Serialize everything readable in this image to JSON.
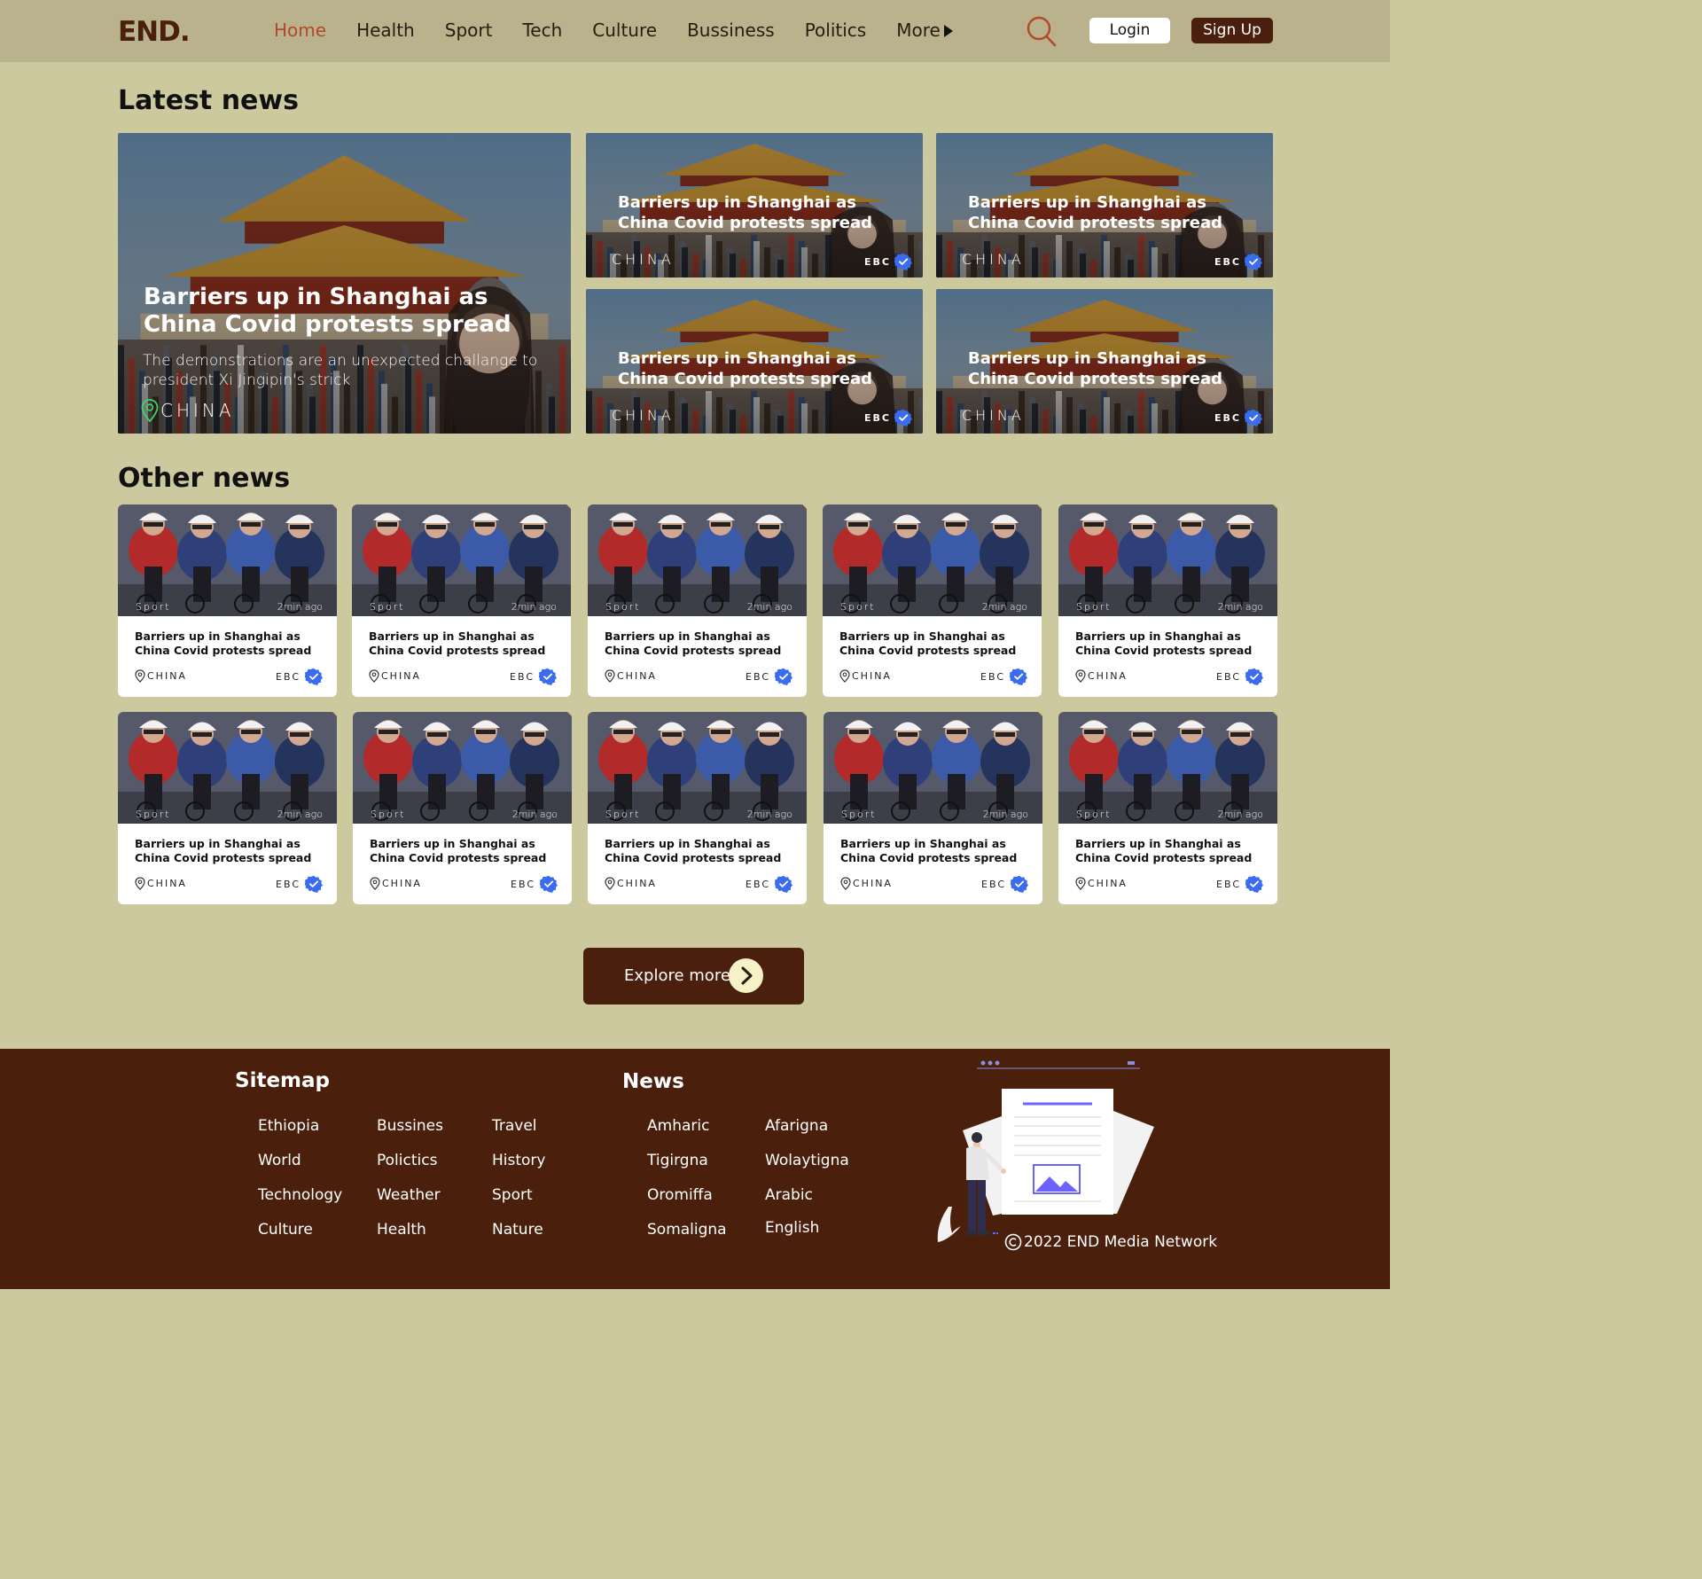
{
  "nav": {
    "logo": "END.",
    "links": [
      "Home",
      "Health",
      "Sport",
      "Tech",
      "Culture",
      "Bussiness",
      "Politics",
      "More"
    ],
    "active_index": 0,
    "login_label": "Login",
    "signup_label": "Sign Up"
  },
  "latest": {
    "heading": "Latest news",
    "hero": {
      "title": "Barriers up in Shanghai as China Covid protests spread",
      "description": "The demonstrations are an unexpected challange to president Xi Jingipin's strick",
      "location": "CHINA"
    },
    "small": [
      {
        "title": "Barriers up in Shanghai as China Covid protests spread",
        "location": "CHINA",
        "source": "EBC"
      },
      {
        "title": "Barriers up in Shanghai as China Covid protests spread",
        "location": "CHINA",
        "source": "EBC"
      },
      {
        "title": "Barriers up in Shanghai as China Covid protests spread",
        "location": "CHINA",
        "source": "EBC"
      },
      {
        "title": "Barriers up in Shanghai as China Covid protests spread",
        "location": "CHINA",
        "source": "EBC"
      }
    ]
  },
  "other": {
    "heading": "Other news",
    "cards": [
      {
        "category": "Sport",
        "time": "2min ago",
        "title": "Barriers up in Shanghai as China Covid protests spread",
        "location": "CHINA",
        "source": "EBC"
      },
      {
        "category": "Sport",
        "time": "2min ago",
        "title": "Barriers up in Shanghai as China Covid protests spread",
        "location": "CHINA",
        "source": "EBC"
      },
      {
        "category": "Sport",
        "time": "2min ago",
        "title": "Barriers up in Shanghai as China Covid protests spread",
        "location": "CHINA",
        "source": "EBC"
      },
      {
        "category": "Sport",
        "time": "2min ago",
        "title": "Barriers up in Shanghai as China Covid protests spread",
        "location": "CHINA",
        "source": "EBC"
      },
      {
        "category": "Sport",
        "time": "2min ago",
        "title": "Barriers up in Shanghai as China Covid protests spread",
        "location": "CHINA",
        "source": "EBC"
      },
      {
        "category": "Sport",
        "time": "2min ago",
        "title": "Barriers up in Shanghai as China Covid protests spread",
        "location": "CHINA",
        "source": "EBC"
      },
      {
        "category": "Sport",
        "time": "2min ago",
        "title": "Barriers up in Shanghai as China Covid protests spread",
        "location": "CHINA",
        "source": "EBC"
      },
      {
        "category": "Sport",
        "time": "2min ago",
        "title": "Barriers up in Shanghai as China Covid protests spread",
        "location": "CHINA",
        "source": "EBC"
      },
      {
        "category": "Sport",
        "time": "2min ago",
        "title": "Barriers up in Shanghai as China Covid protests spread",
        "location": "CHINA",
        "source": "EBC"
      },
      {
        "category": "Sport",
        "time": "2min ago",
        "title": "Barriers up in Shanghai as China Covid protests spread",
        "location": "CHINA",
        "source": "EBC"
      }
    ],
    "explore_label": "Explore more"
  },
  "footer": {
    "sitemap_title": "Sitemap",
    "sitemap_columns": [
      [
        "Ethiopia",
        "World",
        "Technology",
        "Culture"
      ],
      [
        "Bussines",
        "Polictics",
        "Weather",
        "Health"
      ],
      [
        "Travel",
        "History",
        "Sport",
        "Nature"
      ]
    ],
    "news_title": "News",
    "news_columns": [
      [
        "Amharic",
        "Tigirgna",
        "Oromiffa",
        "Somaligna"
      ],
      [
        "Afarigna",
        "Wolaytigna",
        "Arabic",
        "English"
      ]
    ],
    "copyright": "2022 END Media Network"
  },
  "colors": {
    "page_bg": "#cdc99f",
    "nav_bg": "#b9b28c",
    "brand_dark": "#4a1f0e",
    "active_link": "#b24a2a",
    "verified_badge": "#3b6cf0"
  },
  "icons": {
    "search": "search-icon",
    "location": "location-pin-icon",
    "verified": "verified-badge-icon",
    "explore": "chevron-right-icon",
    "copyright": "copyright-icon"
  }
}
